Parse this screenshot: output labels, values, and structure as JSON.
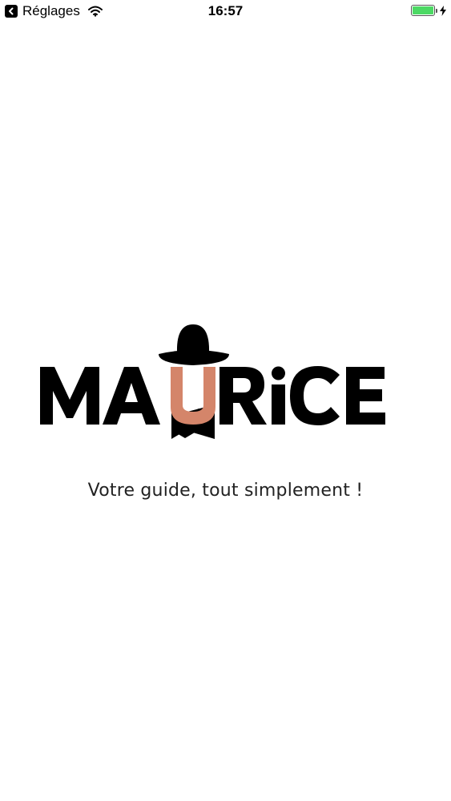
{
  "status_bar": {
    "back_label": "Réglages",
    "time": "16:57",
    "battery_level": 1.0,
    "battery_color": "#4cd964",
    "icons": [
      "chevron-left-icon",
      "wifi-icon",
      "battery-icon",
      "charging-bolt-icon"
    ]
  },
  "splash": {
    "logo_text": "MAURiCE",
    "accent_color": "#d4856a",
    "tagline": "Votre guide, tout simplement !"
  }
}
